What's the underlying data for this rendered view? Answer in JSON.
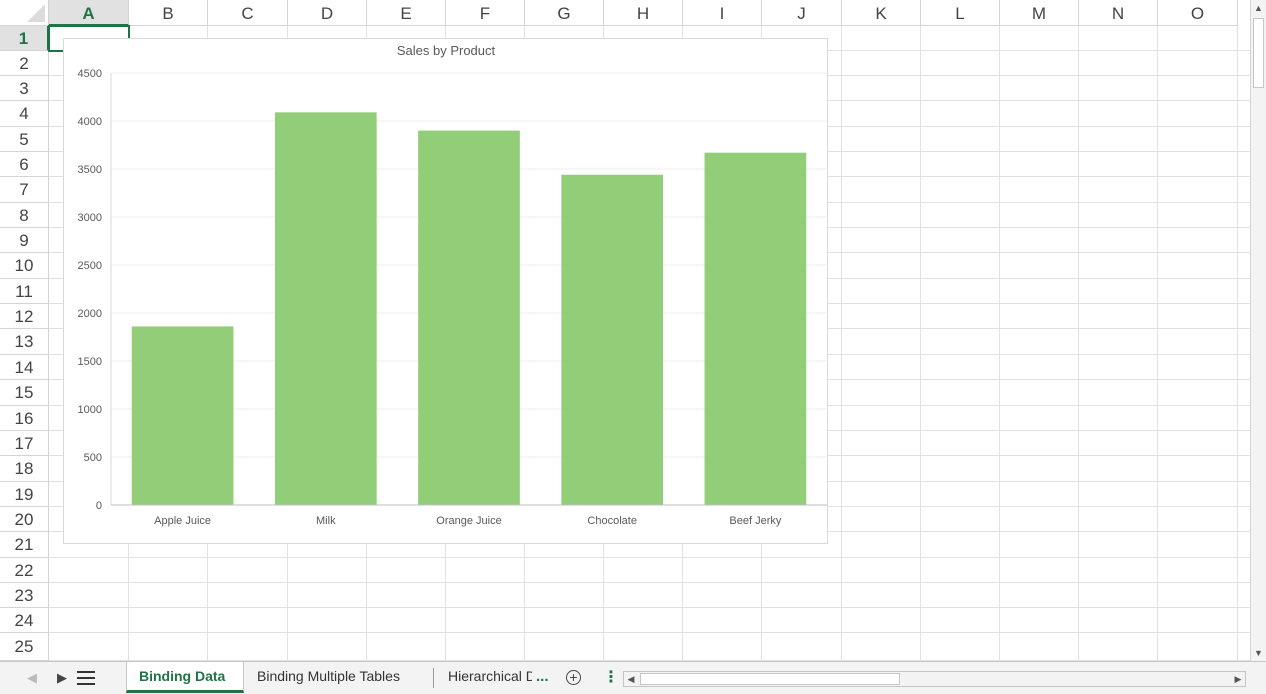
{
  "spreadsheet": {
    "columns": [
      "A",
      "B",
      "C",
      "D",
      "E",
      "F",
      "G",
      "H",
      "I",
      "J",
      "K",
      "L",
      "M",
      "N",
      "O"
    ],
    "rows": [
      "1",
      "2",
      "3",
      "4",
      "5",
      "6",
      "7",
      "8",
      "9",
      "10",
      "11",
      "12",
      "13",
      "14",
      "15",
      "16",
      "17",
      "18",
      "19",
      "20",
      "21",
      "22",
      "23",
      "24",
      "25"
    ],
    "selected_column": "A",
    "selected_row": "1"
  },
  "chart_data": {
    "type": "bar",
    "title": "Sales by Product",
    "categories": [
      "Apple Juice",
      "Milk",
      "Orange Juice",
      "Chocolate",
      "Beef Jerky"
    ],
    "values": [
      1860,
      4090,
      3900,
      3440,
      3670
    ],
    "yticks": [
      "0",
      "500",
      "1000",
      "1500",
      "2000",
      "2500",
      "3000",
      "3500",
      "4000",
      "4500"
    ],
    "ylim": [
      0,
      4500
    ],
    "grid": true,
    "bar_color": "#92cd77"
  },
  "tabbar": {
    "sheets": [
      "Binding Data",
      "Binding Multiple Tables",
      "Hierarchical Data"
    ],
    "active_sheet": "Binding Data",
    "more_label": "...",
    "kebab_label": "⋮"
  },
  "colors": {
    "accent": "#217346",
    "gridline": "#e1e1e1",
    "header_border": "#d4d4d4"
  }
}
